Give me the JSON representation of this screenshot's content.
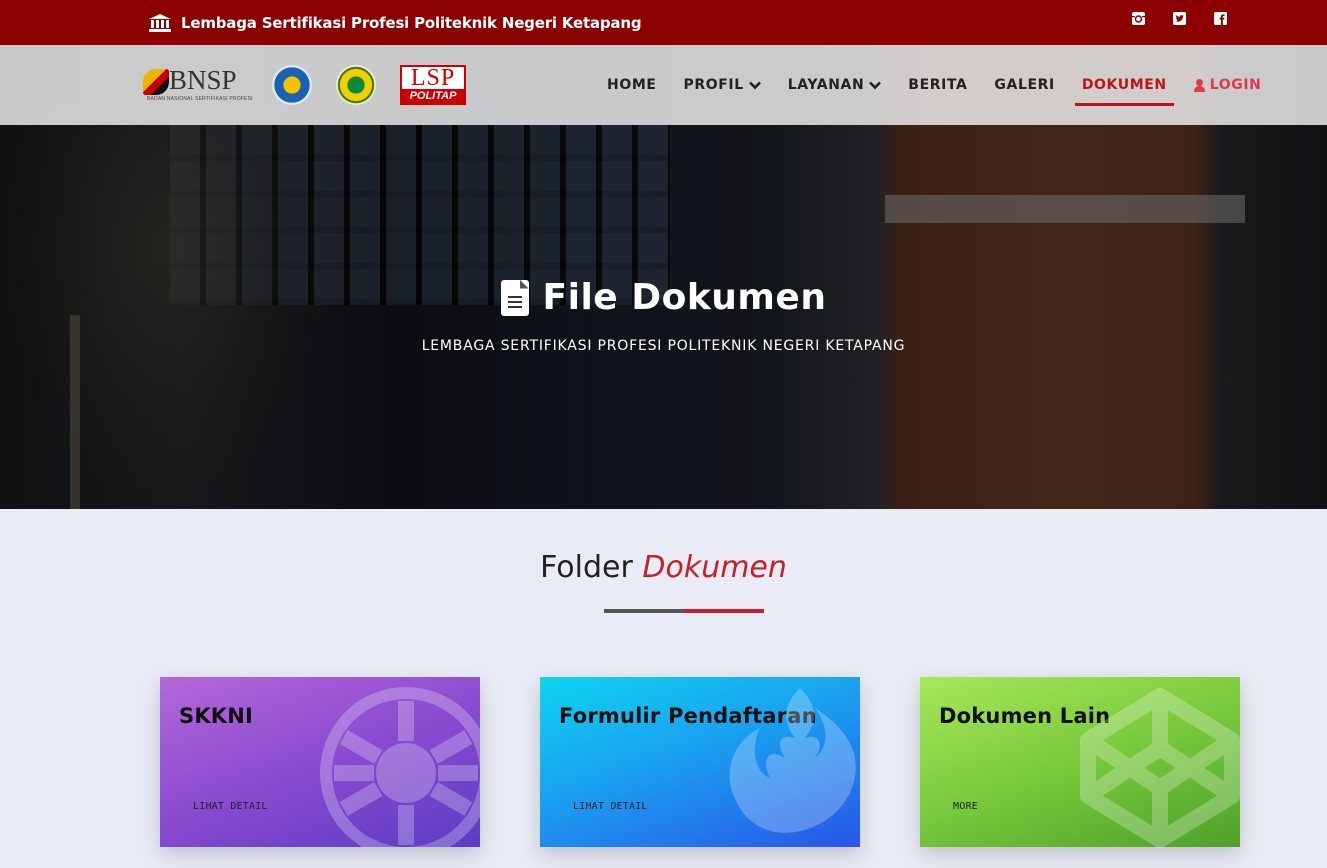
{
  "topbar": {
    "institution_name": "Lembaga Sertifikasi Profesi Politeknik Negeri Ketapang",
    "icons": [
      "institution-icon",
      "instagram-icon",
      "twitter-icon",
      "facebook-icon"
    ]
  },
  "nav": {
    "logos": {
      "bnsp": {
        "word": "BNSP",
        "sub": "BADAN NASIONAL SERTIFIKASI PROFESI"
      },
      "lsp": {
        "top": "LSP",
        "bottom": "POLITAP"
      }
    },
    "menu": [
      {
        "label": "HOME"
      },
      {
        "label": "PROFIL"
      },
      {
        "label": "LAYANAN"
      },
      {
        "label": "BERITA"
      },
      {
        "label": "GALERI"
      },
      {
        "label": "DOKUMEN"
      },
      {
        "label": "LOGIN"
      }
    ],
    "active": "DOKUMEN"
  },
  "hero": {
    "title": "File Dokumen",
    "subtitle": "LEMBAGA SERTIFIKASI PROFESI POLITEKNIK NEGERI KETAPANG"
  },
  "section": {
    "title_plain": "Folder",
    "title_accent": "Dokumen"
  },
  "cards": [
    {
      "title": "SKKNI",
      "link": "LIHAT DETAIL",
      "emblem": "imperial-emblem"
    },
    {
      "title": "Formulir Pendaftaran",
      "link": "LIHAT DETAIL",
      "emblem": "rebel-emblem"
    },
    {
      "title": "Dokumen Lain",
      "link": "MORE",
      "emblem": "codepen-cube-emblem"
    }
  ],
  "colors": {
    "topbar_bg": "#8b0000",
    "accent_red": "#c8202a",
    "page_bg": "#e9ecf6"
  }
}
